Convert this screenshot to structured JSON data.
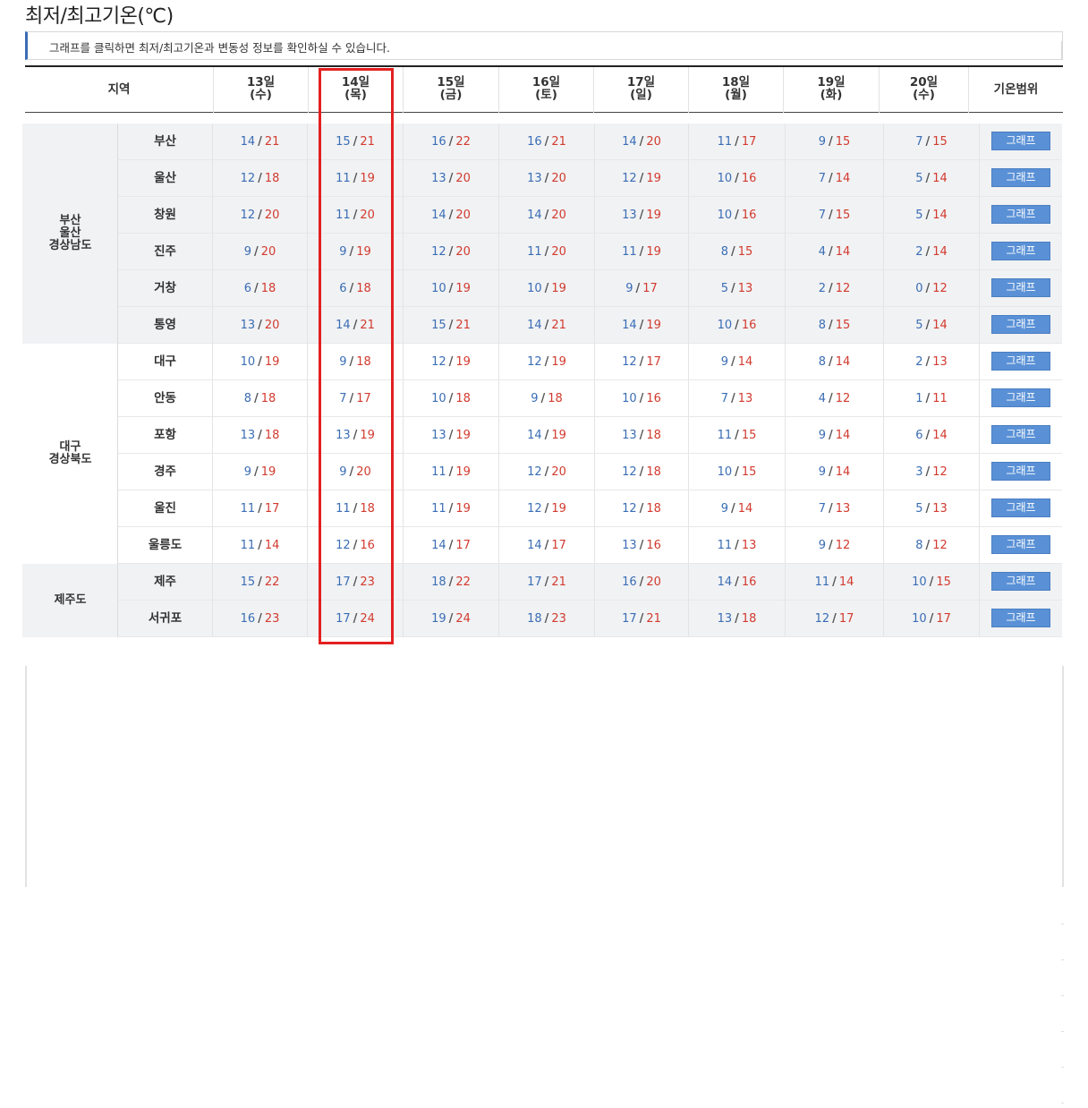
{
  "title": "최저/최고기온(℃)",
  "notice": "그래프를 클릭하면 최저/최고기온과 변동성 정보를 확인하실 수 있습니다.",
  "header": {
    "region": "지역",
    "days": [
      {
        "date": "13일",
        "dow": "(수)"
      },
      {
        "date": "14일",
        "dow": "(목)"
      },
      {
        "date": "15일",
        "dow": "(금)"
      },
      {
        "date": "16일",
        "dow": "(토)"
      },
      {
        "date": "17일",
        "dow": "(일)"
      },
      {
        "date": "18일",
        "dow": "(월)"
      },
      {
        "date": "19일",
        "dow": "(화)"
      },
      {
        "date": "20일",
        "dow": "(수)"
      }
    ],
    "range": "기온범위"
  },
  "regions": [
    {
      "label": [
        "부산",
        "울산",
        "경상남도"
      ]
    },
    {
      "label": [
        "대구",
        "경상북도"
      ]
    },
    {
      "label": [
        "제주도"
      ]
    }
  ],
  "button_label": "그래프",
  "colors": {
    "low": "#3a6db4",
    "high": "#d23a2e",
    "highlight": "#e32020",
    "button": "#5a91d6"
  },
  "rows": [
    {
      "city": "부산",
      "temps": [
        [
          "14",
          "21"
        ],
        [
          "15",
          "21"
        ],
        [
          "16",
          "22"
        ],
        [
          "16",
          "21"
        ],
        [
          "14",
          "20"
        ],
        [
          "11",
          "17"
        ],
        [
          "9",
          "15"
        ],
        [
          "7",
          "15"
        ]
      ]
    },
    {
      "city": "울산",
      "temps": [
        [
          "12",
          "18"
        ],
        [
          "11",
          "19"
        ],
        [
          "13",
          "20"
        ],
        [
          "13",
          "20"
        ],
        [
          "12",
          "19"
        ],
        [
          "10",
          "16"
        ],
        [
          "7",
          "14"
        ],
        [
          "5",
          "14"
        ]
      ]
    },
    {
      "city": "창원",
      "temps": [
        [
          "12",
          "20"
        ],
        [
          "11",
          "20"
        ],
        [
          "14",
          "20"
        ],
        [
          "14",
          "20"
        ],
        [
          "13",
          "19"
        ],
        [
          "10",
          "16"
        ],
        [
          "7",
          "15"
        ],
        [
          "5",
          "14"
        ]
      ]
    },
    {
      "city": "진주",
      "temps": [
        [
          "9",
          "20"
        ],
        [
          "9",
          "19"
        ],
        [
          "12",
          "20"
        ],
        [
          "11",
          "20"
        ],
        [
          "11",
          "19"
        ],
        [
          "8",
          "15"
        ],
        [
          "4",
          "14"
        ],
        [
          "2",
          "14"
        ]
      ]
    },
    {
      "city": "거창",
      "temps": [
        [
          "6",
          "18"
        ],
        [
          "6",
          "18"
        ],
        [
          "10",
          "19"
        ],
        [
          "10",
          "19"
        ],
        [
          "9",
          "17"
        ],
        [
          "5",
          "13"
        ],
        [
          "2",
          "12"
        ],
        [
          "0",
          "12"
        ]
      ]
    },
    {
      "city": "통영",
      "temps": [
        [
          "13",
          "20"
        ],
        [
          "14",
          "21"
        ],
        [
          "15",
          "21"
        ],
        [
          "14",
          "21"
        ],
        [
          "14",
          "19"
        ],
        [
          "10",
          "16"
        ],
        [
          "8",
          "15"
        ],
        [
          "5",
          "14"
        ]
      ]
    },
    {
      "city": "대구",
      "temps": [
        [
          "10",
          "19"
        ],
        [
          "9",
          "18"
        ],
        [
          "12",
          "19"
        ],
        [
          "12",
          "19"
        ],
        [
          "12",
          "17"
        ],
        [
          "9",
          "14"
        ],
        [
          "8",
          "14"
        ],
        [
          "2",
          "13"
        ]
      ]
    },
    {
      "city": "안동",
      "temps": [
        [
          "8",
          "18"
        ],
        [
          "7",
          "17"
        ],
        [
          "10",
          "18"
        ],
        [
          "9",
          "18"
        ],
        [
          "10",
          "16"
        ],
        [
          "7",
          "13"
        ],
        [
          "4",
          "12"
        ],
        [
          "1",
          "11"
        ]
      ]
    },
    {
      "city": "포항",
      "temps": [
        [
          "13",
          "18"
        ],
        [
          "13",
          "19"
        ],
        [
          "13",
          "19"
        ],
        [
          "14",
          "19"
        ],
        [
          "13",
          "18"
        ],
        [
          "11",
          "15"
        ],
        [
          "9",
          "14"
        ],
        [
          "6",
          "14"
        ]
      ]
    },
    {
      "city": "경주",
      "temps": [
        [
          "9",
          "19"
        ],
        [
          "9",
          "20"
        ],
        [
          "11",
          "19"
        ],
        [
          "12",
          "20"
        ],
        [
          "12",
          "18"
        ],
        [
          "10",
          "15"
        ],
        [
          "9",
          "14"
        ],
        [
          "3",
          "12"
        ]
      ]
    },
    {
      "city": "울진",
      "temps": [
        [
          "11",
          "17"
        ],
        [
          "11",
          "18"
        ],
        [
          "11",
          "19"
        ],
        [
          "12",
          "19"
        ],
        [
          "12",
          "18"
        ],
        [
          "9",
          "14"
        ],
        [
          "7",
          "13"
        ],
        [
          "5",
          "13"
        ]
      ]
    },
    {
      "city": "울릉도",
      "temps": [
        [
          "11",
          "14"
        ],
        [
          "12",
          "16"
        ],
        [
          "14",
          "17"
        ],
        [
          "14",
          "17"
        ],
        [
          "13",
          "16"
        ],
        [
          "11",
          "13"
        ],
        [
          "9",
          "12"
        ],
        [
          "8",
          "12"
        ]
      ]
    },
    {
      "city": "제주",
      "temps": [
        [
          "15",
          "22"
        ],
        [
          "17",
          "23"
        ],
        [
          "18",
          "22"
        ],
        [
          "17",
          "21"
        ],
        [
          "16",
          "20"
        ],
        [
          "14",
          "16"
        ],
        [
          "11",
          "14"
        ],
        [
          "10",
          "15"
        ]
      ]
    },
    {
      "city": "서귀포",
      "temps": [
        [
          "16",
          "23"
        ],
        [
          "17",
          "24"
        ],
        [
          "19",
          "24"
        ],
        [
          "18",
          "23"
        ],
        [
          "17",
          "21"
        ],
        [
          "13",
          "18"
        ],
        [
          "12",
          "17"
        ],
        [
          "10",
          "17"
        ]
      ]
    }
  ]
}
